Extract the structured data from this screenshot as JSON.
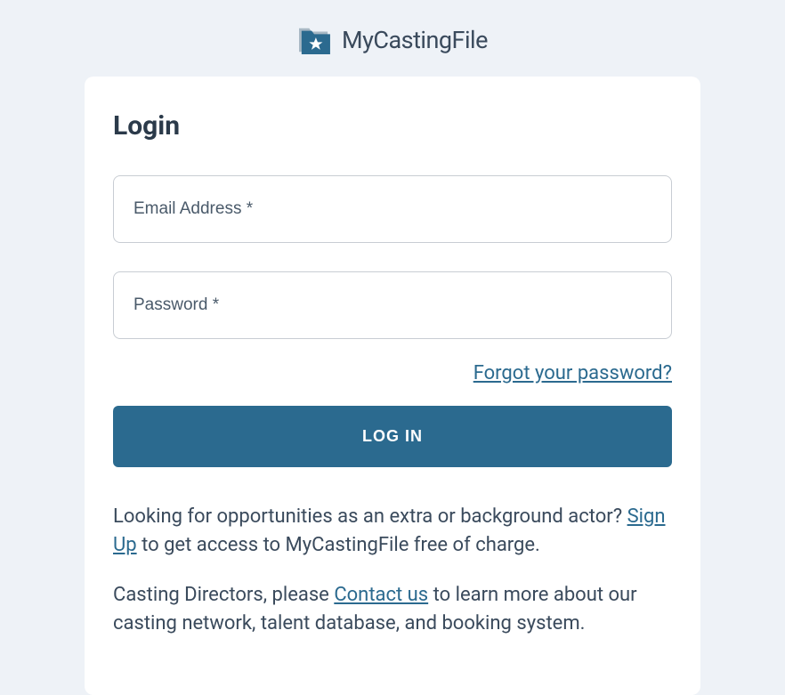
{
  "brand": {
    "name": "MyCastingFile"
  },
  "login": {
    "title": "Login",
    "email_placeholder": "Email Address *",
    "password_placeholder": "Password *",
    "forgot_link": "Forgot your password?",
    "submit_label": "LOG IN"
  },
  "signup_block": {
    "pre_text": "Looking for opportunities as an extra or background actor? ",
    "link_text": "Sign Up",
    "post_text": " to get access to MyCastingFile free of charge."
  },
  "directors_block": {
    "pre_text": "Casting Directors, please ",
    "link_text": "Contact us",
    "post_text": " to learn more about our casting network, talent database, and booking system."
  }
}
